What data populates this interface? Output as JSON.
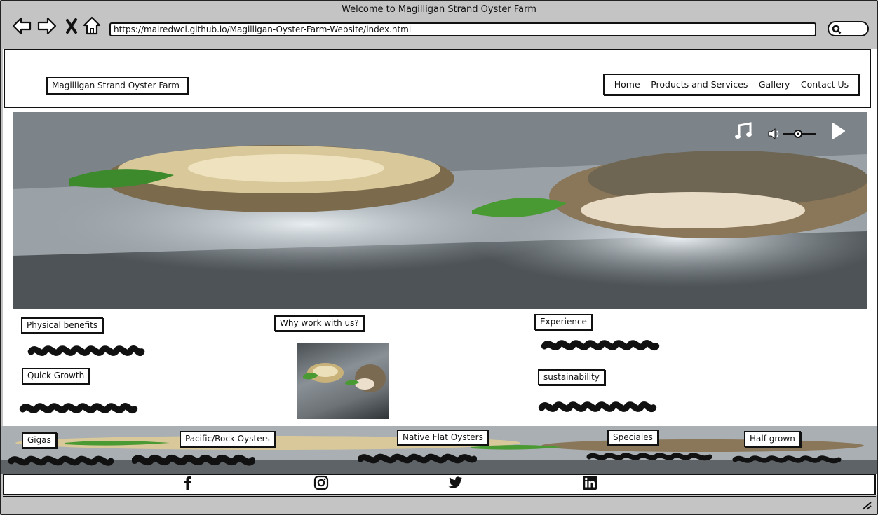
{
  "browser": {
    "title": "Welcome to Magilligan Strand Oyster Farm",
    "url": "https://mairedwci.github.io/Magilligan-Oyster-Farm-Website/index.html"
  },
  "site": {
    "title": "Magilligan Strand Oyster Farm",
    "nav": [
      "Home",
      "Products and Services",
      "Gallery",
      "Contact Us"
    ]
  },
  "features": {
    "physical_benefits": "Physical benefits",
    "quick_growth": "Quick Growth",
    "why_work": "Why work with us?",
    "experience": "Experience",
    "sustainability": "sustainability"
  },
  "products": [
    "Gigas",
    "Pacific/Rock Oysters",
    "Native Flat Oysters",
    "Speciales",
    "Half grown"
  ],
  "social_icons": [
    "facebook-icon",
    "instagram-icon",
    "twitter-icon",
    "linkedin-icon"
  ],
  "hero_controls": [
    "music-icon",
    "volume-slider",
    "play-icon"
  ]
}
